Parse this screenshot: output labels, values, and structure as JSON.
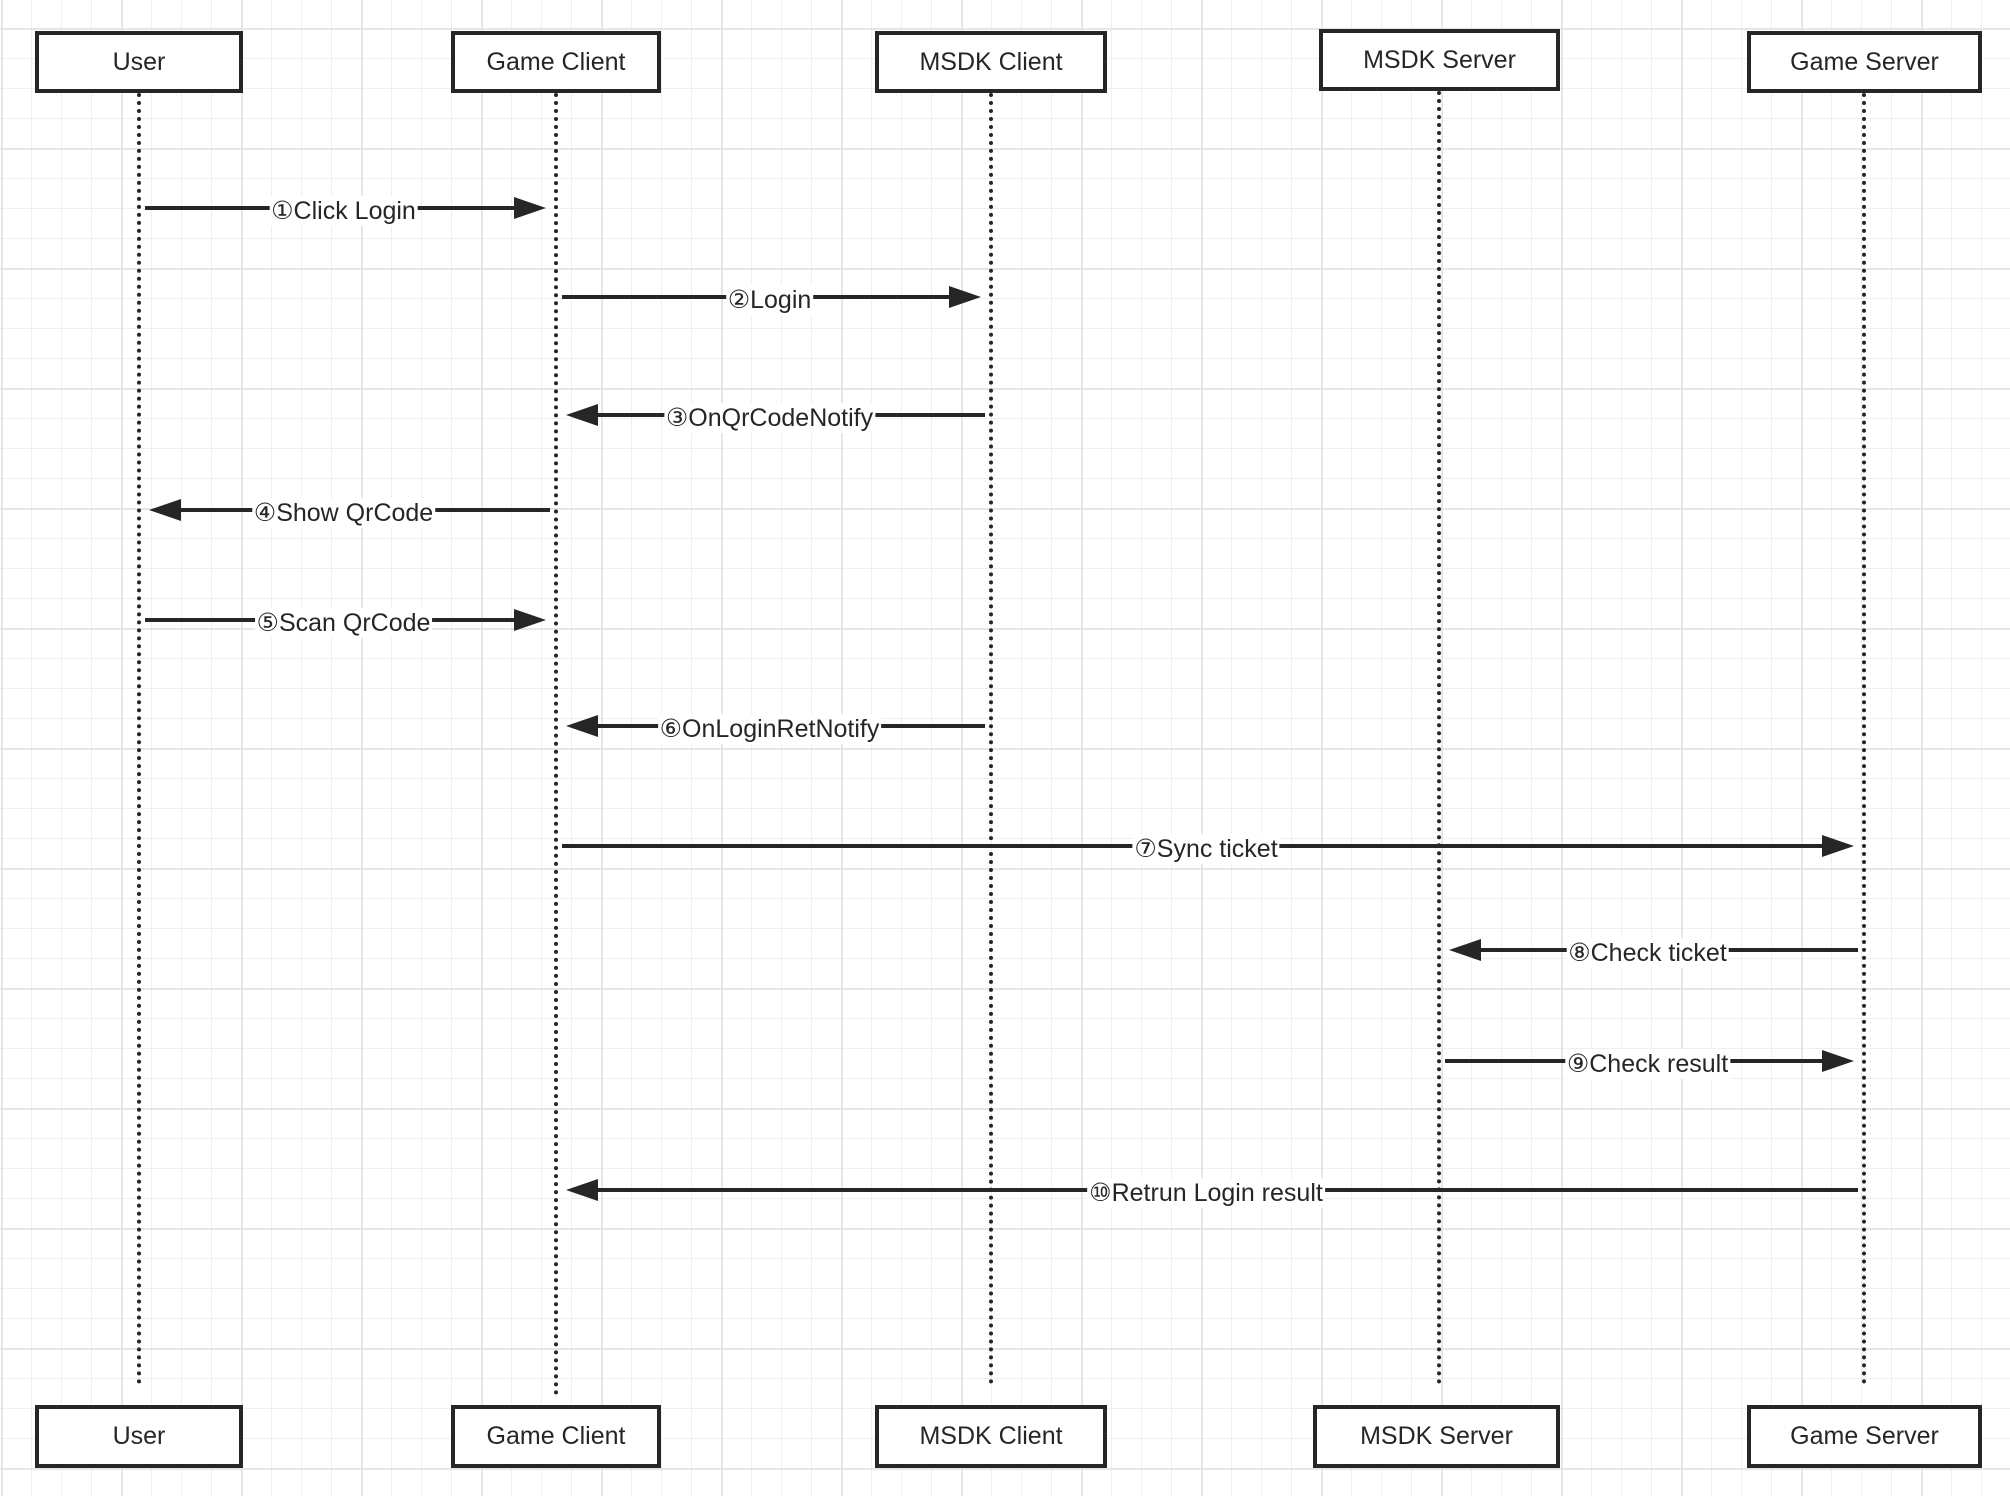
{
  "diagram": {
    "type": "sequence",
    "participants": [
      {
        "id": "user",
        "label": "User"
      },
      {
        "id": "game-client",
        "label": "Game Client"
      },
      {
        "id": "msdk-client",
        "label": "MSDK Client"
      },
      {
        "id": "msdk-server",
        "label": "MSDK Server"
      },
      {
        "id": "game-server",
        "label": "Game Server"
      }
    ],
    "messages": [
      {
        "from": "user",
        "to": "game-client",
        "label": "①Click Login"
      },
      {
        "from": "game-client",
        "to": "msdk-client",
        "label": "②Login"
      },
      {
        "from": "msdk-client",
        "to": "game-client",
        "label": "③OnQrCodeNotify"
      },
      {
        "from": "game-client",
        "to": "user",
        "label": "④Show QrCode"
      },
      {
        "from": "user",
        "to": "game-client",
        "label": "⑤Scan QrCode"
      },
      {
        "from": "msdk-client",
        "to": "game-client",
        "label": "⑥OnLoginRetNotify"
      },
      {
        "from": "game-client",
        "to": "game-server",
        "label": "⑦Sync ticket"
      },
      {
        "from": "game-server",
        "to": "msdk-server",
        "label": "⑧Check ticket"
      },
      {
        "from": "msdk-server",
        "to": "game-server",
        "label": "⑨Check result"
      },
      {
        "from": "game-server",
        "to": "game-client",
        "label": "⑩Retrun Login result"
      }
    ]
  }
}
